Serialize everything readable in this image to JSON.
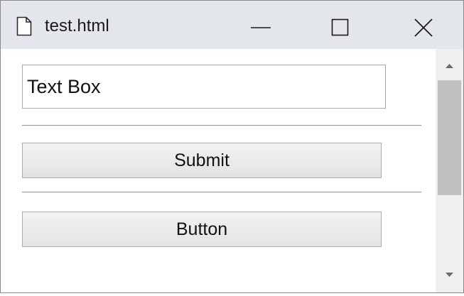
{
  "window": {
    "title": "test.html",
    "icons": {
      "document": "document-icon",
      "minimize": "minimize-icon",
      "maximize": "maximize-icon",
      "close": "close-icon"
    }
  },
  "form": {
    "text_box": {
      "value": "Text Box"
    },
    "submit_label": "Submit",
    "button_label": "Button"
  },
  "scrollbar": {
    "up_icon": "scroll-up-arrow-icon",
    "down_icon": "scroll-down-arrow-icon"
  },
  "colors": {
    "titlebar_bg": "#e3e6ea",
    "scrollbar_track": "#f0f0f0",
    "scrollbar_thumb": "#c1c1c1"
  }
}
